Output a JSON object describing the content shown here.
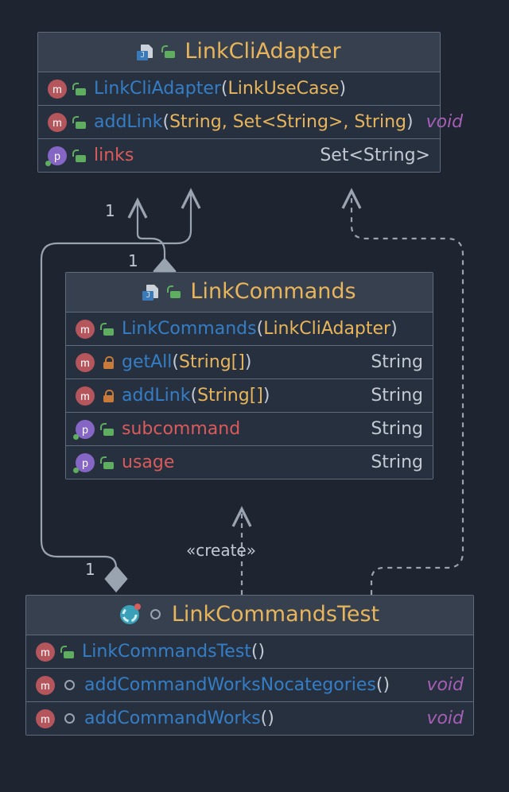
{
  "classes": {
    "linkCliAdapter": {
      "title": "LinkCliAdapter",
      "members": {
        "ctor": {
          "name": "LinkCliAdapter",
          "params": "LinkUseCase"
        },
        "addLink": {
          "name": "addLink",
          "params": "String, Set<String>, String",
          "returns": "void"
        },
        "links": {
          "name": "links",
          "returns": "Set<String>"
        }
      }
    },
    "linkCommands": {
      "title": "LinkCommands",
      "members": {
        "ctor": {
          "name": "LinkCommands",
          "params": "LinkCliAdapter"
        },
        "getAll": {
          "name": "getAll",
          "params": "String[]",
          "returns": "String"
        },
        "addLink": {
          "name": "addLink",
          "params": "String[]",
          "returns": "String"
        },
        "subcommand": {
          "name": "subcommand",
          "returns": "String"
        },
        "usage": {
          "name": "usage",
          "returns": "String"
        }
      }
    },
    "linkCommandsTest": {
      "title": "LinkCommandsTest",
      "members": {
        "ctor": {
          "name": "LinkCommandsTest",
          "params": ""
        },
        "noCat": {
          "name": "addCommandWorksNocategories",
          "params": "",
          "returns": "void"
        },
        "works": {
          "name": "addCommandWorks",
          "params": "",
          "returns": "void"
        }
      }
    }
  },
  "relations": {
    "createLabel": "«create»",
    "mult": {
      "one_a": "1",
      "one_b": "1",
      "one_c": "1"
    }
  }
}
